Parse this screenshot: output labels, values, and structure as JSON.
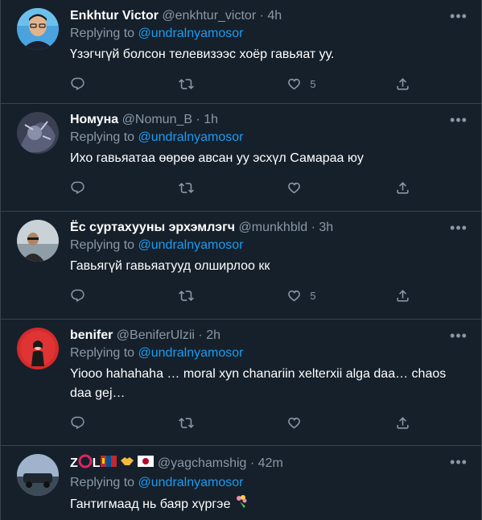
{
  "replying_to_prefix": "Replying to",
  "tweets": [
    {
      "name": "Enkhtur Victor",
      "handle": "@enkhtur_victor",
      "time": "4h",
      "reply_to": "@undralnyamosor",
      "text": "Үзэгчгүй болсон телевизээс хоёр гавьяат уу.",
      "likes": "5",
      "avatar_color": "#4aa3df"
    },
    {
      "name": "Номуна",
      "handle": "@Nomun_B",
      "time": "1h",
      "reply_to": "@undralnyamosor",
      "text": "Ихо гавьяатаа өөрөө авсан уу эсхүл Самараа юу",
      "likes": "",
      "avatar_color": "#3b3f52"
    },
    {
      "name": "Ёс суртахууны эрхэмлэгч",
      "handle": "@munkhbld",
      "time": "3h",
      "reply_to": "@undralnyamosor",
      "text": "Гавьягүй гавьяатууд олширлоо кк",
      "likes": "5",
      "avatar_color": "#c9d2d6"
    },
    {
      "name": "benifer",
      "handle": "@BeniferUlzii",
      "time": "2h",
      "reply_to": "@undralnyamosor",
      "text": "Yiooo hahahaha … moral xyn chanariin xelterxii alga daa… chaos daa gej…",
      "likes": "",
      "avatar_color": "#d42a2a"
    },
    {
      "name": "Z",
      "handle": "@yagchamshig",
      "time": "42m",
      "reply_to": "@undralnyamosor",
      "text": "Гантигмаад нь баяр хүргэе",
      "likes": "",
      "avatar_color": "#7d8fa8"
    }
  ],
  "colors": {
    "background": "#15202b",
    "accent": "#1d9bf0",
    "muted": "#8b98a5",
    "border": "#38444d"
  },
  "icons": [
    "reply-icon",
    "retweet-icon",
    "like-icon",
    "share-icon",
    "more-icon"
  ]
}
